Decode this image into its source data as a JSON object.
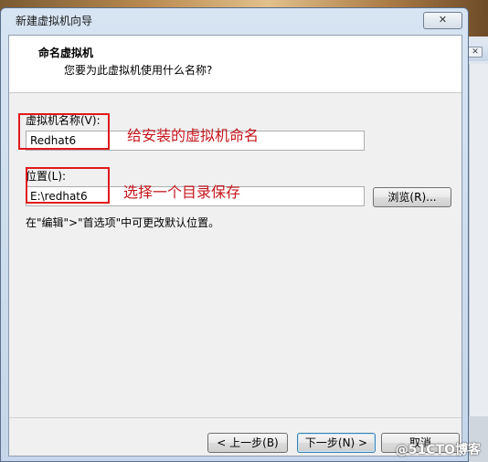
{
  "window": {
    "title": "新建虚拟机向导",
    "close_glyph": "✕"
  },
  "header": {
    "title": "命名虚拟机",
    "subtitle": "您要为此虚拟机使用什么名称?"
  },
  "vm_name": {
    "label": "虚拟机名称(V):",
    "value": "Redhat6"
  },
  "location": {
    "label": "位置(L):",
    "value": "E:\\redhat6",
    "browse_label": "浏览(R)..."
  },
  "hint": "在\"编辑\">\"首选项\"中可更改默认位置。",
  "annotations": {
    "name_note": "给安装的虚拟机命名",
    "location_note": "选择一个目录保存"
  },
  "buttons": {
    "back": "< 上一步(B)",
    "next": "下一步(N) >",
    "cancel": "取消"
  },
  "watermark": "@51CTO博客",
  "colors": {
    "annotation_red": "#e0191b",
    "title_bar": "#c5d6ea"
  }
}
